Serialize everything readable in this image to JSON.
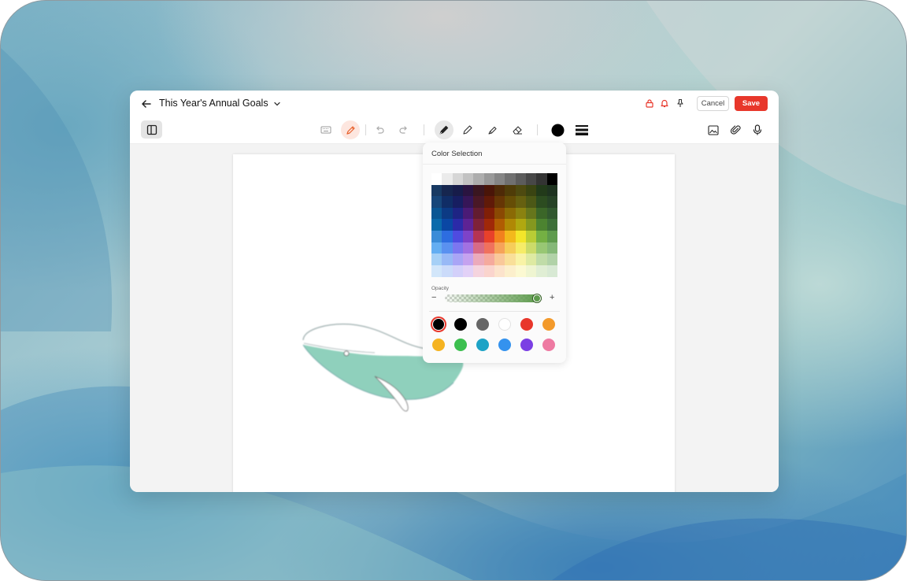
{
  "header": {
    "title": "This Year's Annual Goals",
    "cancel_label": "Cancel",
    "save_label": "Save"
  },
  "toolbar": {
    "current_color": "#000000"
  },
  "color_popover": {
    "title": "Color Selection",
    "opacity_label": "Opacity",
    "opacity_minus": "−",
    "opacity_plus": "+",
    "opacity_value": 0.95,
    "selected_swatch": 0,
    "swatches": [
      "#000000",
      "#000000",
      "#666666",
      "#ffffff",
      "#e8372b",
      "#f39a2b",
      "#f5b321",
      "#3cbf4f",
      "#1ea3c6",
      "#3492ee",
      "#7b3fe4",
      "#ee7aa2"
    ]
  },
  "palette_columns": [
    [
      "#ffffff",
      "#183a63",
      "#17467a",
      "#0a5694",
      "#0a6aab",
      "#3a8cd8",
      "#64aef2",
      "#a6d0f6",
      "#d2e6fa"
    ],
    [
      "#ebebeb",
      "#16264f",
      "#102d66",
      "#0c3a84",
      "#0a47a4",
      "#2d6de0",
      "#5a91f0",
      "#98b9f6",
      "#cbdbfa"
    ],
    [
      "#d6d6d6",
      "#171c4a",
      "#171e61",
      "#1e2484",
      "#2b2aa8",
      "#4f4be0",
      "#7c76f0",
      "#a9a5f6",
      "#d3d0fa"
    ],
    [
      "#c2c2c2",
      "#2a1440",
      "#361658",
      "#4a1b76",
      "#5d2394",
      "#7e43c8",
      "#a271e2",
      "#c5a2ef",
      "#e2d1f7"
    ],
    [
      "#adadad",
      "#3a1620",
      "#4a1826",
      "#621c30",
      "#7e2238",
      "#b53454",
      "#d76b86",
      "#ebaabb",
      "#f5d4de"
    ],
    [
      "#999999",
      "#4a1508",
      "#601a08",
      "#801f06",
      "#a02808",
      "#e8412a",
      "#f0715d",
      "#f5aa9d",
      "#fad4cd"
    ],
    [
      "#858585",
      "#4e2a07",
      "#663605",
      "#8a4903",
      "#b05c02",
      "#f2801e",
      "#f6a35a",
      "#f9c89a",
      "#fce3cc"
    ],
    [
      "#707070",
      "#4f3c08",
      "#664e06",
      "#8a6a05",
      "#b08805",
      "#f3b81c",
      "#f6cd5a",
      "#f9df99",
      "#fcefcc"
    ],
    [
      "#5c5c5c",
      "#4e4a10",
      "#666010",
      "#8a8210",
      "#b0a810",
      "#f3e52a",
      "#f6ec68",
      "#f9f3a6",
      "#fcf9d2"
    ],
    [
      "#474747",
      "#3a4412",
      "#4c5816",
      "#66761c",
      "#84981f",
      "#b9cc35",
      "#cbdb6a",
      "#deeaa2",
      "#eff5d1"
    ],
    [
      "#333333",
      "#223a1a",
      "#2c4c20",
      "#3b6628",
      "#4c8330",
      "#74b043",
      "#98c774",
      "#c0dca8",
      "#e0eed4"
    ],
    [
      "#000000",
      "#1e3320",
      "#264226",
      "#31582f",
      "#3d6f38",
      "#5e9b4d",
      "#85b878",
      "#b1d2a8",
      "#d8e9d4"
    ]
  ]
}
